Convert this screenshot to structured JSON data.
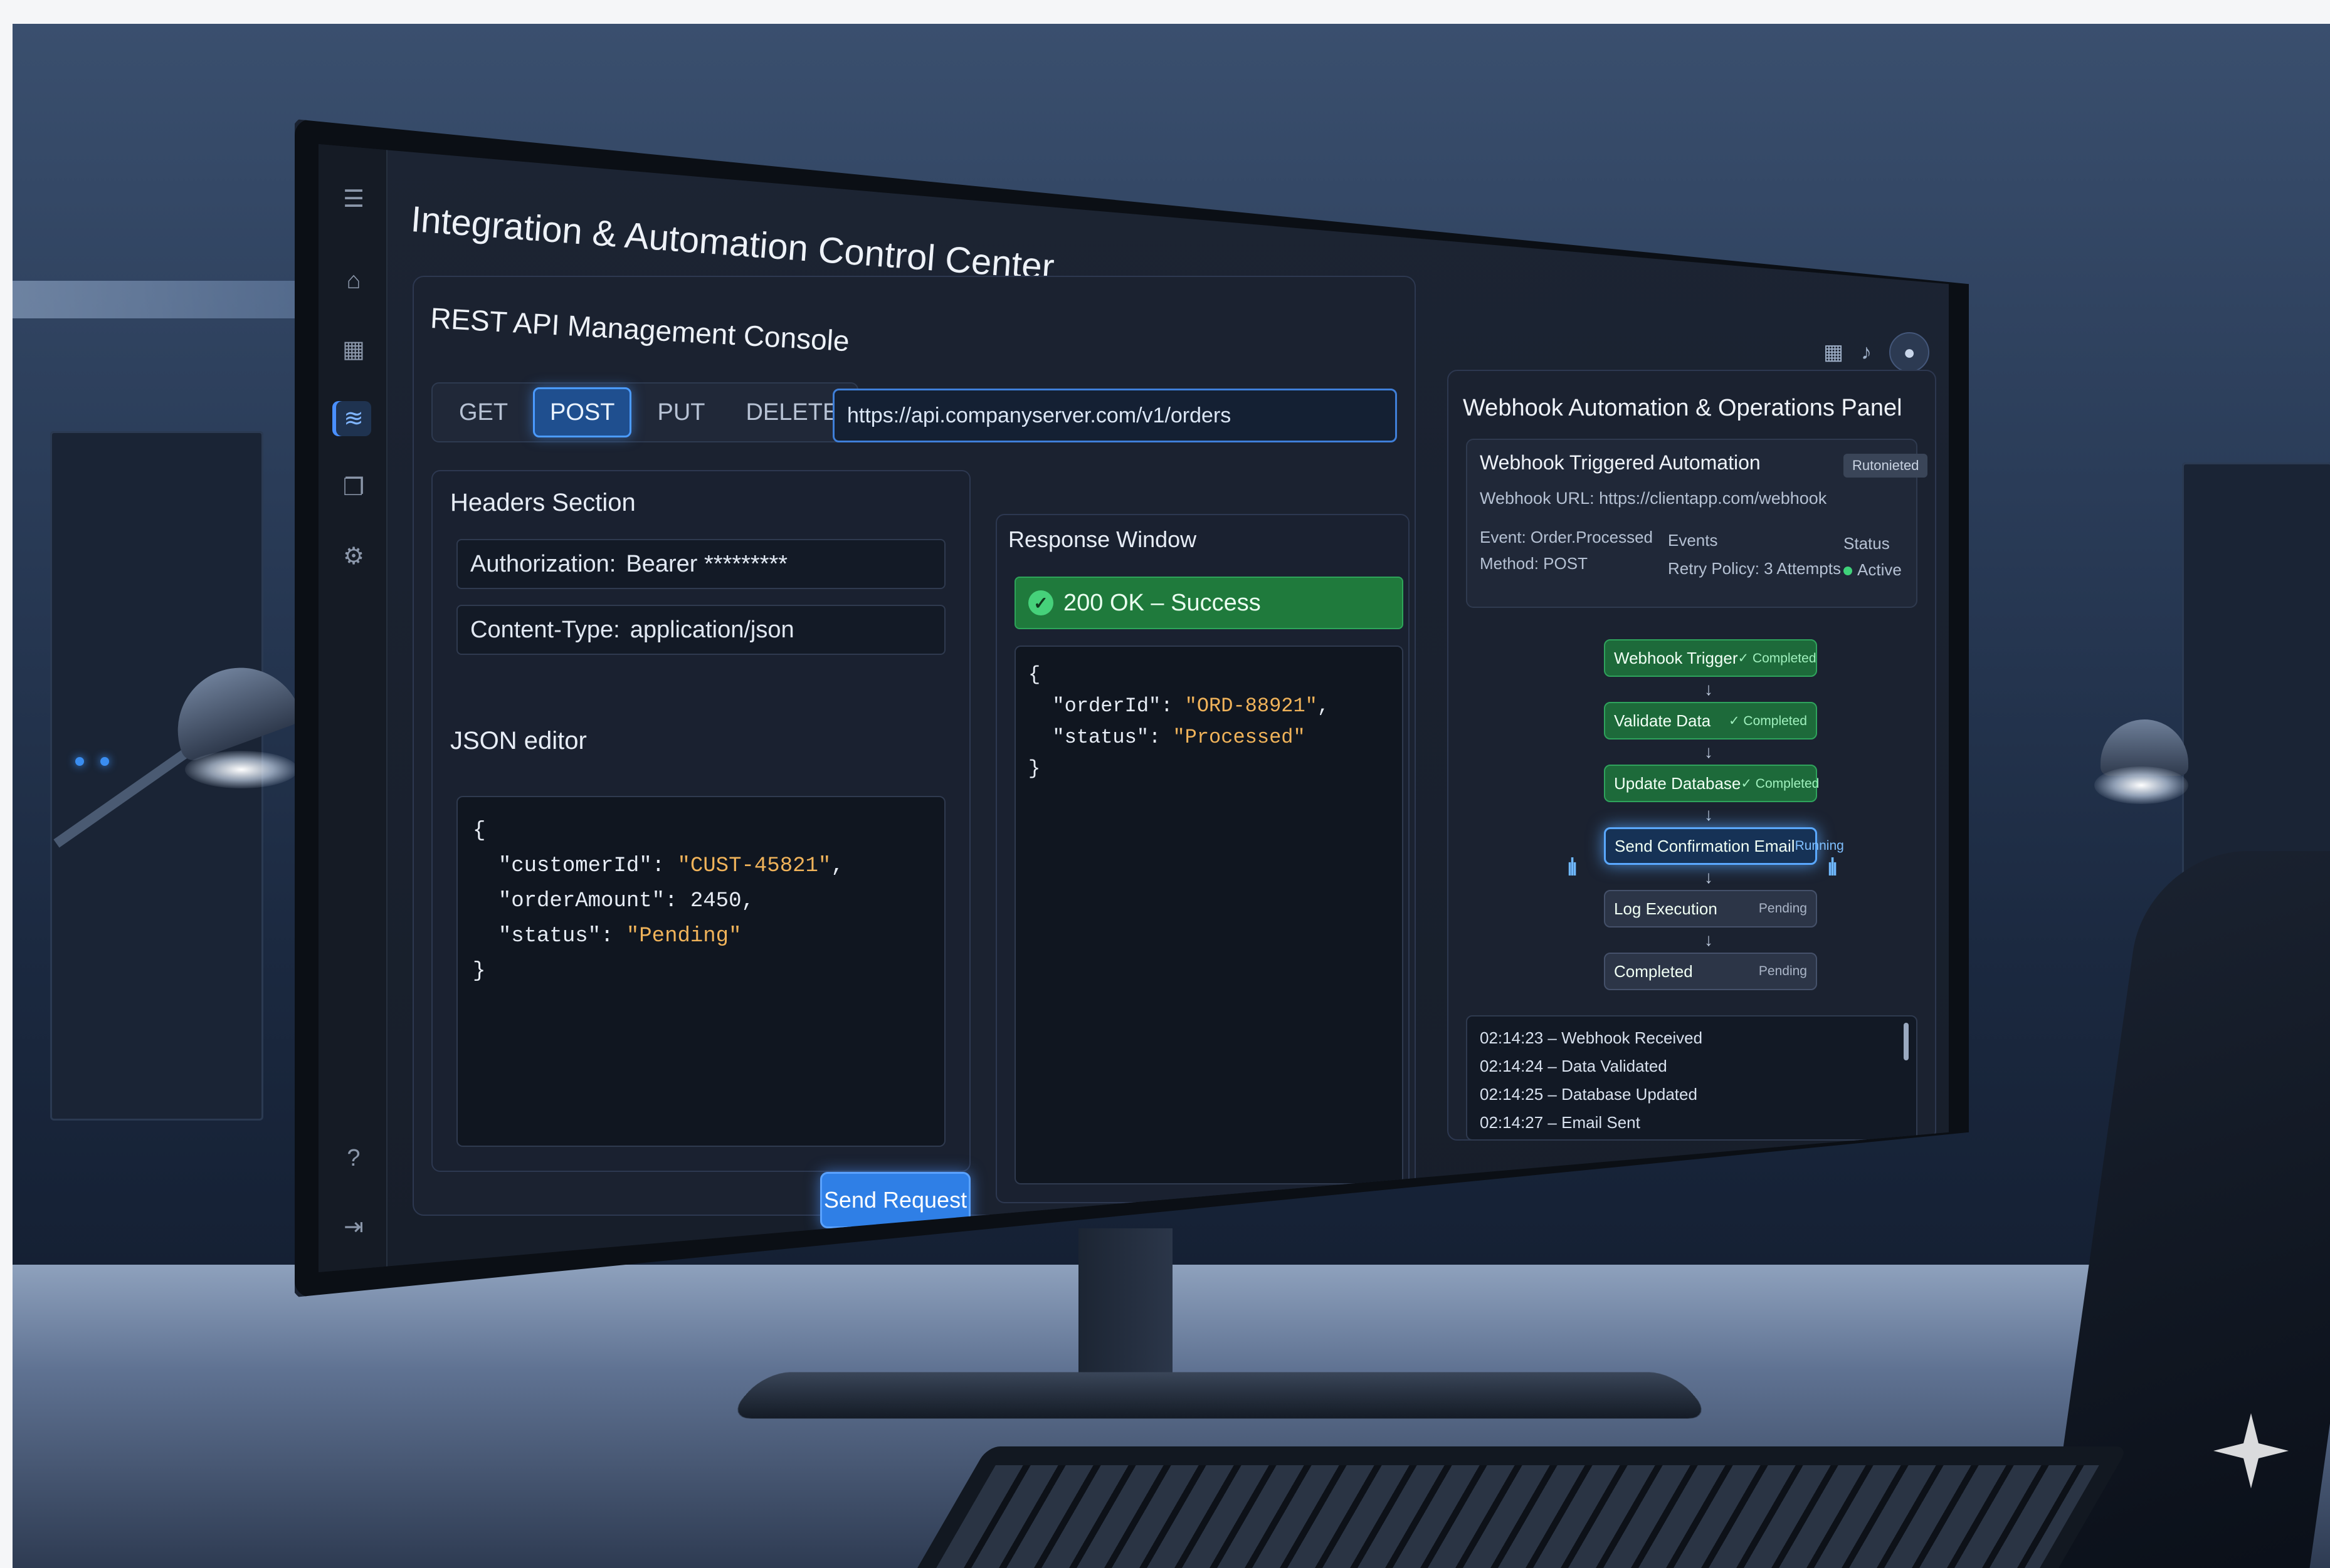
{
  "app": {
    "title": "Integration & Automation Control Center"
  },
  "sidebar": {
    "items": [
      {
        "icon": "menu-icon",
        "glyph": "☰"
      },
      {
        "icon": "home-icon",
        "glyph": "⌂"
      },
      {
        "icon": "grid-icon",
        "glyph": "▦"
      },
      {
        "icon": "layers-icon",
        "glyph": "≋",
        "active": true
      },
      {
        "icon": "copy-icon",
        "glyph": "❐"
      },
      {
        "icon": "settings-icon",
        "glyph": "⚙"
      },
      {
        "icon": "help-icon",
        "glyph": "?"
      },
      {
        "icon": "logout-icon",
        "glyph": "⇥"
      }
    ]
  },
  "console": {
    "title": "REST API Management Console",
    "methods": [
      "GET",
      "POST",
      "PUT",
      "DELETE"
    ],
    "active_method": "POST",
    "url": "https://api.companyserver.com/v1/orders",
    "headers_label": "Headers Section",
    "headers": [
      {
        "key": "Authorization:",
        "value": "Bearer *********"
      },
      {
        "key": "Content-Type:",
        "value": "application/json"
      }
    ],
    "json_label": "JSON editor",
    "json": {
      "open": "{",
      "line1_key": "\"customerId\"",
      "line1_val": "\"CUST-45821\"",
      "line2_key": "\"orderAmount\"",
      "line2_val": "2450",
      "line3_key": "\"status\"",
      "line3_val": "\"Pending\"",
      "close": "}"
    },
    "send_label": "Send Request"
  },
  "response": {
    "label": "Response Window",
    "status": "200 OK – Success",
    "status_color": "#1f7a3c",
    "json": {
      "open": "{",
      "line1_key": "\"orderId\"",
      "line1_val": "\"ORD-88921\"",
      "line2_key": "\"status\"",
      "line2_val": "\"Processed\"",
      "close": "}"
    }
  },
  "topbar": {
    "icons": [
      "calendar-icon",
      "bell-icon",
      "user-avatar"
    ]
  },
  "webhook": {
    "panel_title": "Webhook Automation & Operations Panel",
    "card_title": "Webhook Triggered Automation",
    "badge": "Rutonieted",
    "url": "Webhook URL: https://clientapp.com/webhook",
    "event": "Event: Order.Processed",
    "method": "Method: POST",
    "events_label": "Events",
    "retry": "Retry Policy: 3 Attempts",
    "status_label": "Status",
    "status_value": "Active",
    "flow": [
      {
        "label": "Webhook Trigger",
        "status": "✓ Completed",
        "state": "completed"
      },
      {
        "label": "Validate Data",
        "status": "✓ Completed",
        "state": "completed"
      },
      {
        "label": "Update Database",
        "status": "✓ Completed",
        "state": "completed"
      },
      {
        "label": "Send Confirmation Email",
        "status": "Running",
        "state": "running"
      },
      {
        "label": "Log Execution",
        "status": "Pending",
        "state": "pending"
      },
      {
        "label": "Completed",
        "status": "Pending",
        "state": "pending"
      }
    ],
    "logs": [
      "02:14:23 – Webhook Received",
      "02:14:24 – Data Validated",
      "02:14:25 – Database Updated",
      "02:14:27 – Email Sent"
    ]
  },
  "colors": {
    "accent": "#4b9bff",
    "success": "#2fa35c",
    "running": "#5aa8ff"
  }
}
